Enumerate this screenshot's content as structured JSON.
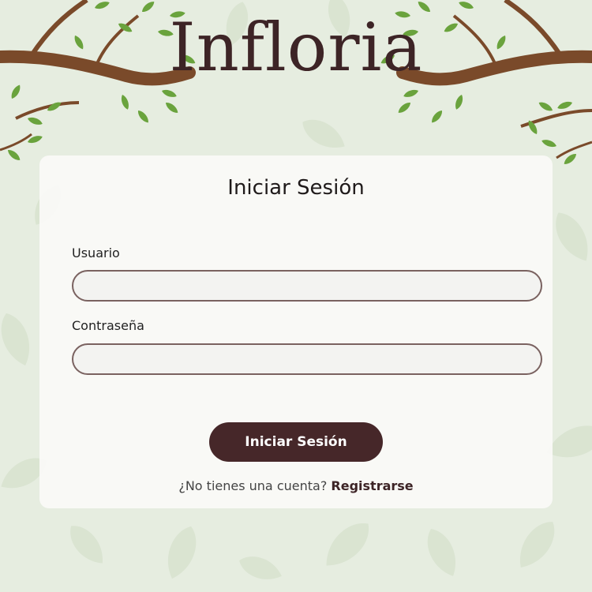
{
  "brand": {
    "name": "Infloria"
  },
  "login": {
    "title": "Iniciar Sesión",
    "username_label": "Usuario",
    "username_value": "",
    "password_label": "Contraseña",
    "password_value": "",
    "submit_label": "Iniciar Sesión",
    "register_prompt": "¿No tienes una cuenta?",
    "register_link": "Registrarse"
  },
  "colors": {
    "brand_text": "#3d2426",
    "button_bg": "#462729",
    "input_border": "#7a6260",
    "background": "#e6ede0"
  },
  "icons": [
    "tree-branch-decoration-left",
    "tree-branch-decoration-right",
    "leaf-background-pattern"
  ]
}
